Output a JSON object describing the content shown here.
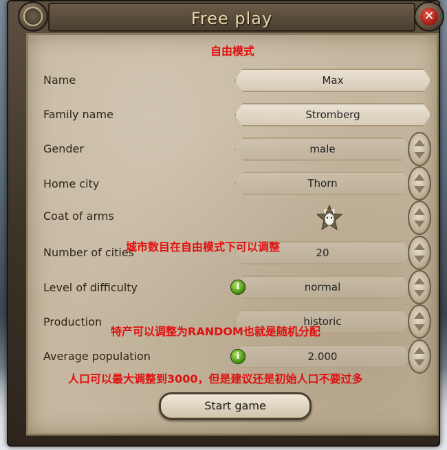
{
  "window": {
    "title": "Free play",
    "subtitle_cn": "自由模式"
  },
  "rows": [
    {
      "label": "Name",
      "value": "Max"
    },
    {
      "label": "Family name",
      "value": "Stromberg"
    },
    {
      "label": "Gender",
      "value": "male"
    },
    {
      "label": "Home city",
      "value": "Thorn"
    },
    {
      "label": "Coat of arms",
      "value": ""
    },
    {
      "label": "Number of cities",
      "value": "20"
    },
    {
      "label": "Level of difficulty",
      "value": "normal"
    },
    {
      "label": "Production",
      "value": "historic"
    },
    {
      "label": "Average population",
      "value": "2.000"
    }
  ],
  "annotations": {
    "cities": "城市数目在自由模式下可以调整",
    "production": "特产可以调整为RANDOM也就是随机分配",
    "population": "人口可以最大调整到3000，但是建议还是初始人口不要过多"
  },
  "buttons": {
    "start": "Start game",
    "close_symbol": "✕"
  },
  "icons": {
    "info": "i",
    "close": "close-icon",
    "globe": "globe-icon",
    "coat": "goat-star-coat-of-arms-icon"
  }
}
